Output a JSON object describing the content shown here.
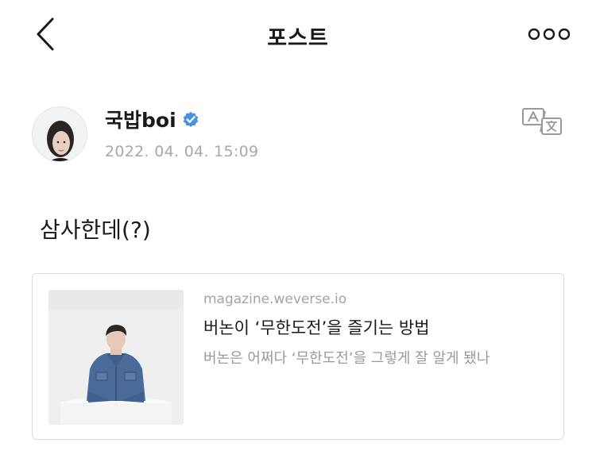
{
  "header": {
    "title": "포스트",
    "back_icon": "chevron-left-icon",
    "more_icon": "more-horizontal-icon"
  },
  "post": {
    "author": {
      "name": "국밥boi",
      "verified": true,
      "verified_color": "#4a90e2",
      "avatar_icon": "user-avatar"
    },
    "timestamp": "2022. 04. 04. 15:09",
    "translate_icon": "translate-icon",
    "text": "삼사한데(?)",
    "link_card": {
      "domain": "magazine.weverse.io",
      "title": "버논이 ‘무한도전’을 즐기는 방법",
      "description": "버논은 어쩌다 ‘무한도전’을 그렇게 잘 알게 됐나",
      "thumbnail": "article-thumbnail"
    }
  }
}
